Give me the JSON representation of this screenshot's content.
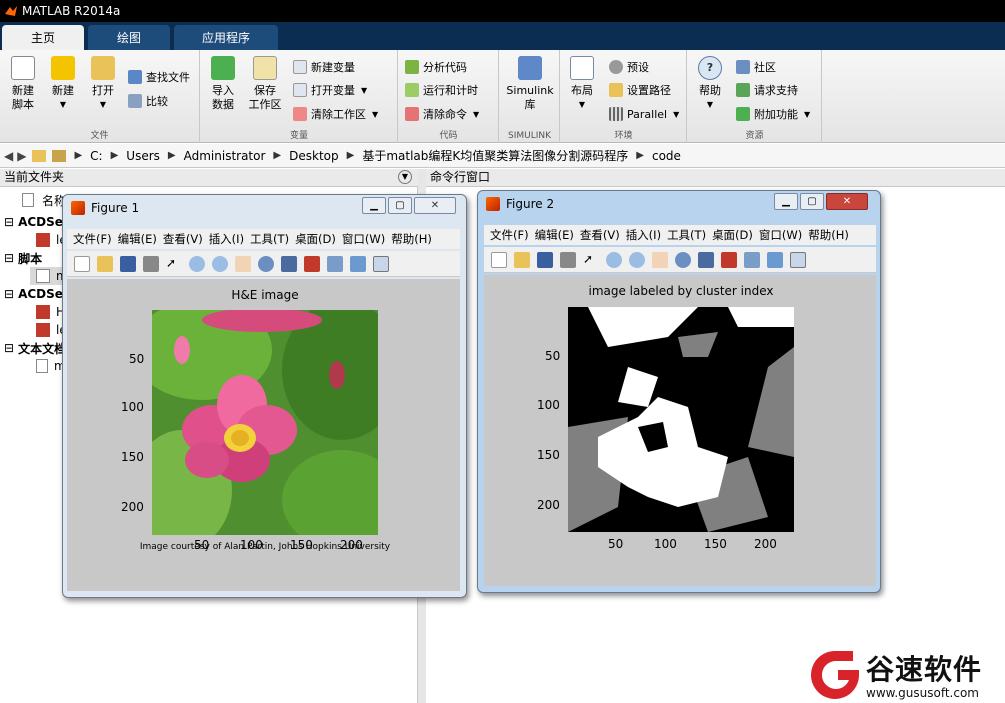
{
  "app": {
    "title": "MATLAB R2014a"
  },
  "tabs": [
    {
      "label": "主页"
    },
    {
      "label": "绘图"
    },
    {
      "label": "应用程序"
    }
  ],
  "ribbon": {
    "file": {
      "new_script": "新建\n脚本",
      "new": "新建",
      "open": "打开",
      "find_files": "查找文件",
      "compare": "比较",
      "group": "文件"
    },
    "variable": {
      "import": "导入\n数据",
      "save_ws": "保存\n工作区",
      "new_var": "新建变量",
      "open_var": "打开变量",
      "clear_ws": "清除工作区",
      "group": "变量"
    },
    "code": {
      "analyze": "分析代码",
      "run_time": "运行和计时",
      "clear_cmd": "清除命令",
      "group": "代码"
    },
    "simulink": {
      "lib": "Simulink\n库",
      "group": "SIMULINK"
    },
    "env": {
      "layout": "布局",
      "prefs": "预设",
      "set_path": "设置路径",
      "parallel": "Parallel",
      "group": "环境"
    },
    "resources": {
      "help": "帮助",
      "community": "社区",
      "support": "请求支持",
      "addons": "附加功能",
      "group": "资源"
    }
  },
  "address": {
    "parts": [
      "C:",
      "Users",
      "Administrator",
      "Desktop",
      "基于matlab编程K均值聚类算法图像分割源码程序",
      "code"
    ]
  },
  "left_panel": {
    "header": "当前文件夹",
    "col_name": "名称",
    "items": [
      "ACDSee",
      "le",
      "脚本",
      "m",
      "ACDSee",
      "H",
      "le",
      "文本文档",
      "m"
    ]
  },
  "right_panel": {
    "header": "命令行窗口"
  },
  "figure1": {
    "title": "Figure 1",
    "menu": [
      "文件(F)",
      "编辑(E)",
      "查看(V)",
      "插入(I)",
      "工具(T)",
      "桌面(D)",
      "窗口(W)",
      "帮助(H)"
    ],
    "axes_title": "H&E image",
    "yticks": [
      "50",
      "100",
      "150",
      "200"
    ],
    "xticks": [
      "50",
      "100",
      "150",
      "200"
    ],
    "caption": "Image courtesy of Alan Partin, Johns Hopkins University"
  },
  "figure2": {
    "title": "Figure 2",
    "menu": [
      "文件(F)",
      "编辑(E)",
      "查看(V)",
      "插入(I)",
      "工具(T)",
      "桌面(D)",
      "窗口(W)",
      "帮助(H)"
    ],
    "axes_title": "image labeled by cluster index",
    "yticks": [
      "50",
      "100",
      "150",
      "200"
    ],
    "xticks": [
      "50",
      "100",
      "150",
      "200"
    ]
  },
  "watermark": {
    "cn": "谷速软件",
    "url": "www.gususoft.com"
  },
  "colors": {
    "tabbar": "#0b2d52",
    "ribbon": "#ececec",
    "figure_bg": "#c8c8c8",
    "brand_red": "#d9232b"
  }
}
